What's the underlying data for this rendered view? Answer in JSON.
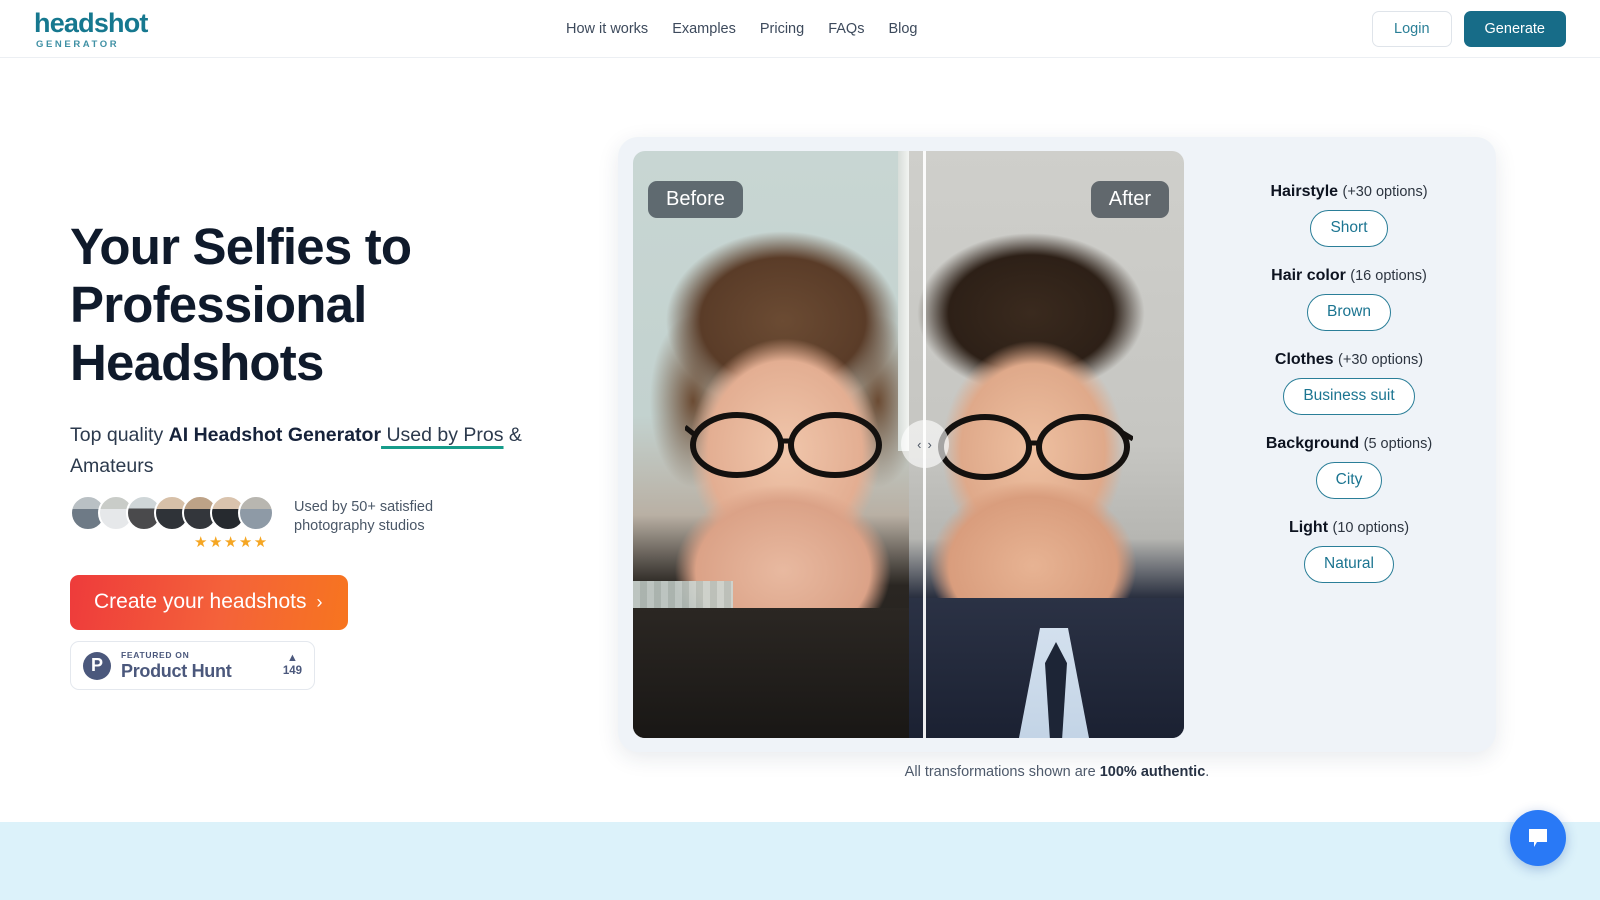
{
  "header": {
    "logo_main": "headshot",
    "logo_sub": "GENERATOR",
    "nav": [
      {
        "label": "How it works"
      },
      {
        "label": "Examples"
      },
      {
        "label": "Pricing"
      },
      {
        "label": "FAQs"
      },
      {
        "label": "Blog"
      }
    ],
    "login_label": "Login",
    "generate_label": "Generate",
    "accent_color": "#176C88"
  },
  "hero": {
    "title": "Your Selfies to Professional Headshots",
    "subtitle_lead": "Top quality ",
    "subtitle_bold": "AI Headshot Generator",
    "subtitle_underlined": " Used by Pros",
    "subtitle_tail": " & Amateurs",
    "social_proof": "Used by 50+ satisfied photography studios",
    "stars": "★★★★★",
    "star_color": "#F5A623",
    "cta_label": "Create your headshots",
    "cta_chevron": "›",
    "product_hunt": {
      "featured_label": "FEATURED ON",
      "name": "Product Hunt",
      "initial": "P",
      "upvote_arrow": "▲",
      "upvote_count": "149"
    }
  },
  "showcase": {
    "before_label": "Before",
    "after_label": "After",
    "caption_lead": "All transformations shown are ",
    "caption_bold": "100% authentic",
    "caption_tail": ".",
    "handle_left": "‹",
    "handle_right": "›",
    "options": [
      {
        "name": "Hairstyle",
        "count": "(+30 options)",
        "value": "Short"
      },
      {
        "name": "Hair color",
        "count": "(16 options)",
        "value": "Brown"
      },
      {
        "name": "Clothes",
        "count": "(+30 options)",
        "value": "Business suit"
      },
      {
        "name": "Background",
        "count": "(5 options)",
        "value": "City"
      },
      {
        "name": "Light",
        "count": "(10 options)",
        "value": "Natural"
      }
    ],
    "pill_color": "#1c7591"
  },
  "chat": {
    "label": "chat-bubble"
  }
}
